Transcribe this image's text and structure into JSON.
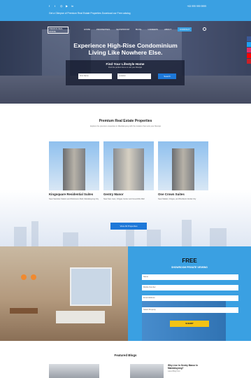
{
  "topbar": {
    "social": [
      "facebook-icon",
      "twitter-icon",
      "instagram-icon",
      "youtube-icon",
      "linkedin-icon"
    ],
    "message": "Get a Glimpse of Premium Real Estate Properties Download our Free catalog",
    "contacts": "+63 999 999 9999"
  },
  "nav": {
    "logo_text": "PREMIUM REAL ESTATE",
    "items": [
      "HOME",
      "PROPERTIES",
      "SHOWROOM",
      "BLOG",
      "CAREERS",
      "ABOUT",
      "CONTACT"
    ]
  },
  "hero": {
    "headline_line1": "Experience High-Rise Condominium",
    "headline_line2": "Living Like Nowhere Else.",
    "form_title": "Find Your Lifestyle Home",
    "form_subtitle": "Find the perfect home to suit your lifestyle",
    "field1_placeholder": "First Name",
    "field2_placeholder": "Location",
    "search_label": "Search"
  },
  "properties": {
    "heading": "Premium Real Estate Properties",
    "subheading": "Explore the premium properties in Mandaluyong with the location that suits your lifestyle",
    "cards": [
      {
        "name": "Kingsquare Residential Suites",
        "desc": "Near Santolan Station and Robinsons Mall, Mandaluyong City"
      },
      {
        "name": "Gentry Manor",
        "desc": "Near San Juan, Ortigas Center and Greenhills Mall"
      },
      {
        "name": "One Crown Suites",
        "desc": "Near Makati, Ortigas, and Bonifacio Global City"
      }
    ],
    "view_all": "View All Properties"
  },
  "showroom": {
    "title": "FREE",
    "subtitle": "SHOWROOM PRIVATE VIEWING",
    "fields": [
      "Name",
      "Mobile Number",
      "Email Address",
      "Select Property"
    ],
    "submit": "SUBMIT"
  },
  "blogs": {
    "heading": "Featured Blogs",
    "post_title": "Why Live In Gentry Manor In Mandaluyong?",
    "post_meta": "Latest Blog Post"
  },
  "colors": {
    "accent": "#3aa0e2",
    "button": "#1e78d8",
    "submit": "#f3c316"
  }
}
